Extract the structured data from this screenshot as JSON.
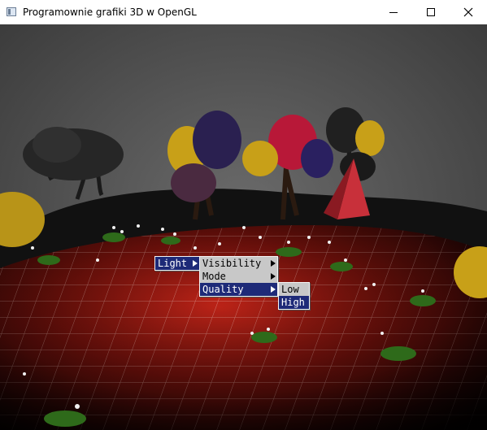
{
  "window": {
    "title": "Programownie grafiki 3D w OpenGL"
  },
  "menus": {
    "root": {
      "items": [
        {
          "label": "Light",
          "has_submenu": true,
          "highlighted": true
        }
      ]
    },
    "light_submenu": {
      "items": [
        {
          "label": "Visibility",
          "has_submenu": true,
          "highlighted": false
        },
        {
          "label": "Mode",
          "has_submenu": true,
          "highlighted": false
        },
        {
          "label": "Quality",
          "has_submenu": true,
          "highlighted": true
        }
      ]
    },
    "quality_submenu": {
      "items": [
        {
          "label": "Low",
          "highlighted": false
        },
        {
          "label": "High",
          "highlighted": true
        }
      ]
    }
  },
  "colors": {
    "menu_highlight": "#1e2a78",
    "menu_background": "#c8c8c8",
    "floor": "#8a1a14",
    "grid": "#f0c8c0",
    "sky": "#5a5a5a"
  }
}
